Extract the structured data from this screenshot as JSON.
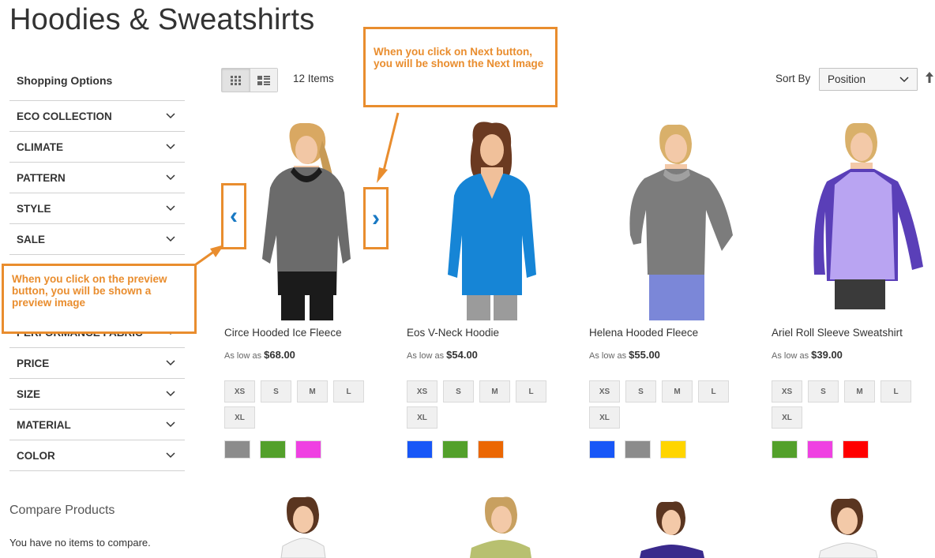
{
  "page": {
    "title": "Hoodies & Sweatshirts"
  },
  "sidebar": {
    "title": "Shopping Options",
    "filters_top": [
      {
        "label": "ECO COLLECTION"
      },
      {
        "label": "CLIMATE"
      },
      {
        "label": "PATTERN"
      },
      {
        "label": "STYLE"
      },
      {
        "label": "SALE"
      }
    ],
    "filters_bottom": [
      {
        "label": "PERFORMANCE FABRIC"
      },
      {
        "label": "PRICE"
      },
      {
        "label": "SIZE"
      },
      {
        "label": "MATERIAL"
      },
      {
        "label": "COLOR"
      }
    ]
  },
  "compare": {
    "title": "Compare Products",
    "text": "You have no items to compare."
  },
  "toolbar": {
    "grid_icon": "grid-icon",
    "list_icon": "list-icon",
    "items_count": "12 Items",
    "sort_label": "Sort By",
    "sort_value": "Position",
    "sort_direction_icon": "arrow-up-icon"
  },
  "products": [
    {
      "name": "Circe Hooded Ice Fleece",
      "price_prefix": "As low as",
      "price": "$68.00",
      "sizes": [
        "XS",
        "S",
        "M",
        "L",
        "XL"
      ],
      "colors": [
        "#8c8c8c",
        "#53a02b",
        "#ef41e2"
      ]
    },
    {
      "name": "Eos V-Neck Hoodie",
      "price_prefix": "As low as",
      "price": "$54.00",
      "sizes": [
        "XS",
        "S",
        "M",
        "L",
        "XL"
      ],
      "colors": [
        "#1857f7",
        "#53a02b",
        "#eb6703"
      ]
    },
    {
      "name": "Helena Hooded Fleece",
      "price_prefix": "As low as",
      "price": "$55.00",
      "sizes": [
        "XS",
        "S",
        "M",
        "L",
        "XL"
      ],
      "colors": [
        "#1857f7",
        "#8c8c8c",
        "#ffd500"
      ]
    },
    {
      "name": "Ariel Roll Sleeve Sweatshirt",
      "price_prefix": "As low as",
      "price": "$39.00",
      "sizes": [
        "XS",
        "S",
        "M",
        "L",
        "XL"
      ],
      "colors": [
        "#53a02b",
        "#ef41e2",
        "#ff0000"
      ]
    }
  ],
  "annotations": {
    "next_note": "When you click on Next button, you will be shown the Next Image",
    "prev_note": "When you click on the preview button, you will be shown a preview image",
    "prev_symbol": "‹",
    "next_symbol": "›"
  },
  "colors": {
    "annotation": "#e98d2e",
    "nav_arrow": "#1979c3"
  }
}
